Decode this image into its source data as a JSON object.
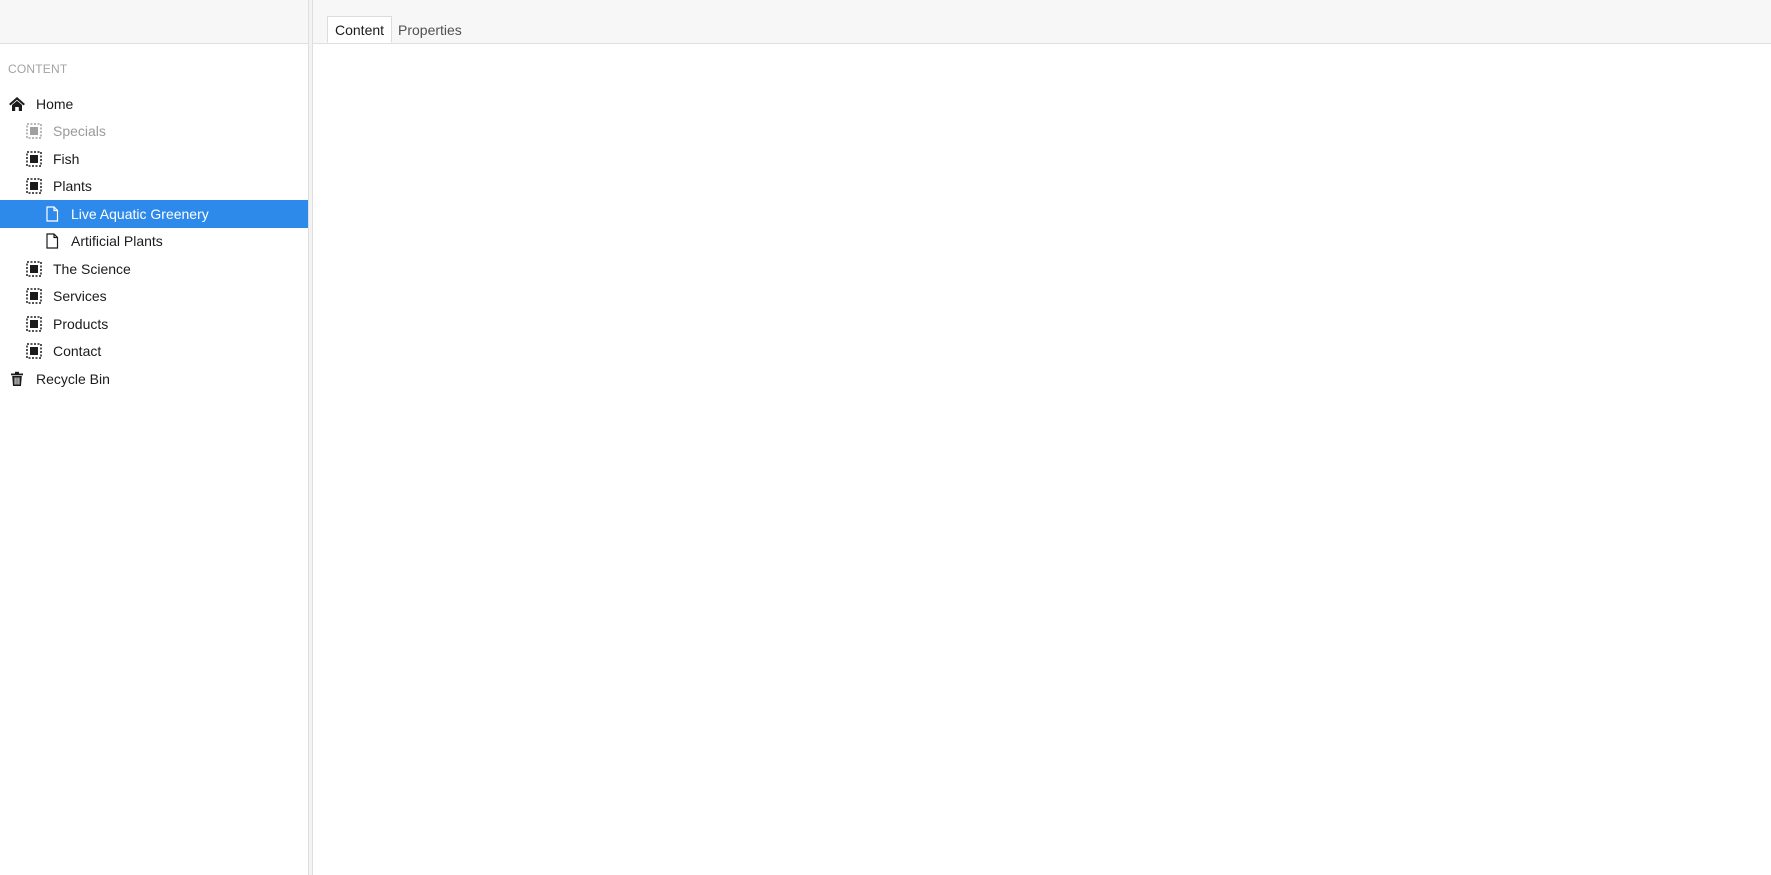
{
  "sidebar": {
    "section_title": "CONTENT",
    "items": [
      {
        "label": "Home",
        "icon": "home-icon",
        "level": 0,
        "state": "normal"
      },
      {
        "label": "Specials",
        "icon": "container-icon",
        "level": 1,
        "state": "muted"
      },
      {
        "label": "Fish",
        "icon": "container-icon",
        "level": 1,
        "state": "normal"
      },
      {
        "label": "Plants",
        "icon": "container-icon",
        "level": 1,
        "state": "normal"
      },
      {
        "label": "Live Aquatic Greenery",
        "icon": "document-icon",
        "level": 2,
        "state": "selected"
      },
      {
        "label": "Artificial Plants",
        "icon": "document-icon",
        "level": 2,
        "state": "normal"
      },
      {
        "label": "The Science",
        "icon": "container-icon",
        "level": 1,
        "state": "normal"
      },
      {
        "label": "Services",
        "icon": "container-icon",
        "level": 1,
        "state": "normal"
      },
      {
        "label": "Products",
        "icon": "container-icon",
        "level": 1,
        "state": "normal"
      },
      {
        "label": "Contact",
        "icon": "container-icon",
        "level": 1,
        "state": "normal"
      },
      {
        "label": "Recycle Bin",
        "icon": "trash-icon",
        "level": 0,
        "state": "normal"
      }
    ]
  },
  "main": {
    "tabs": [
      {
        "label": "Content",
        "active": true
      },
      {
        "label": "Properties",
        "active": false
      }
    ]
  },
  "colors": {
    "selected_bg": "#2e8aea",
    "muted_text": "#9a9a9a"
  }
}
